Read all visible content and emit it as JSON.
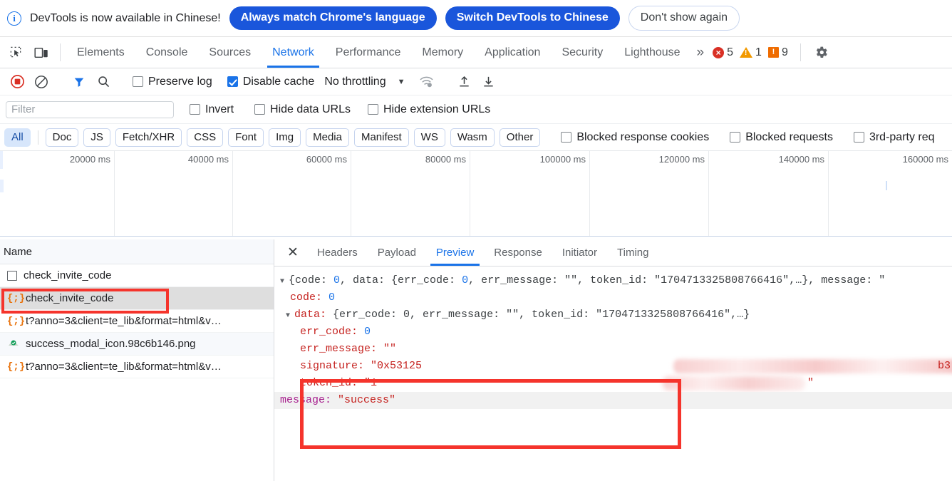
{
  "banner": {
    "icon": "info-circle-icon",
    "text": "DevTools is now available in Chinese!",
    "primary_button": "Always match Chrome's language",
    "secondary_button": "Switch DevTools to Chinese",
    "dismiss_button": "Don't show again"
  },
  "main_tabs": {
    "items": [
      {
        "label": "Elements",
        "active": false
      },
      {
        "label": "Console",
        "active": false
      },
      {
        "label": "Sources",
        "active": false
      },
      {
        "label": "Network",
        "active": true
      },
      {
        "label": "Performance",
        "active": false
      },
      {
        "label": "Memory",
        "active": false
      },
      {
        "label": "Application",
        "active": false
      },
      {
        "label": "Security",
        "active": false
      },
      {
        "label": "Lighthouse",
        "active": false
      }
    ],
    "overflow": "»",
    "counters": {
      "errors": "5",
      "warnings": "1",
      "issues": "9"
    }
  },
  "network_toolbar": {
    "record_icon": "record-stop-icon",
    "clear_icon": "clear-icon",
    "filter_icon": "filter-funnel-icon",
    "search_icon": "search-icon",
    "preserve_log": {
      "label": "Preserve log",
      "checked": false
    },
    "disable_cache": {
      "label": "Disable cache",
      "checked": true
    },
    "throttling": "No throttling",
    "wifi_icon": "network-conditions-icon",
    "import_icon": "import-har-icon",
    "export_icon": "export-har-icon"
  },
  "filter_bar": {
    "filter_placeholder": "Filter",
    "filter_value": "",
    "invert": {
      "label": "Invert",
      "checked": false
    },
    "hide_data_urls": {
      "label": "Hide data URLs",
      "checked": false
    },
    "hide_extension_urls": {
      "label": "Hide extension URLs",
      "checked": false
    }
  },
  "type_filters": {
    "chips": [
      "All",
      "Doc",
      "JS",
      "Fetch/XHR",
      "CSS",
      "Font",
      "Img",
      "Media",
      "Manifest",
      "WS",
      "Wasm",
      "Other"
    ],
    "active_chip": "All",
    "blocked_response_cookies": {
      "label": "Blocked response cookies",
      "checked": false
    },
    "blocked_requests": {
      "label": "Blocked requests",
      "checked": false
    },
    "third_party": {
      "label": "3rd-party req",
      "checked": false
    }
  },
  "timeline": {
    "ticks": [
      "20000 ms",
      "40000 ms",
      "60000 ms",
      "80000 ms",
      "100000 ms",
      "120000 ms",
      "140000 ms",
      "160000 ms"
    ]
  },
  "request_list": {
    "column_header": "Name",
    "rows": [
      {
        "icon": "document-icon",
        "name": "check_invite_code",
        "selected": false
      },
      {
        "icon": "json-icon",
        "name": "check_invite_code",
        "selected": true
      },
      {
        "icon": "json-icon",
        "name": "t?anno=3&client=te_lib&format=html&v…",
        "selected": false
      },
      {
        "icon": "image-icon",
        "name": "success_modal_icon.98c6b146.png",
        "selected": false
      },
      {
        "icon": "json-icon",
        "name": "t?anno=3&client=te_lib&format=html&v…",
        "selected": false
      }
    ]
  },
  "detail_panel": {
    "close_icon": "close-icon",
    "tabs": [
      {
        "label": "Headers",
        "active": false
      },
      {
        "label": "Payload",
        "active": false
      },
      {
        "label": "Preview",
        "active": true
      },
      {
        "label": "Response",
        "active": false
      },
      {
        "label": "Initiator",
        "active": false
      },
      {
        "label": "Timing",
        "active": false
      }
    ],
    "preview": {
      "root_summary_prefix": "{code: ",
      "root_code": "0",
      "root_mid": ", data: {err_code: ",
      "root_err_code": "0",
      "root_mid2": ", err_message: ",
      "root_empty": "\"\"",
      "root_mid3": ", token_id: ",
      "root_token": "\"1704713325808766416\"",
      "root_tail": ",…}, message: \"",
      "code_key": "code:",
      "code_value": "0",
      "data_key": "data:",
      "data_summary": "{err_code: 0, err_message: \"\", token_id: \"1704713325808766416\",…}",
      "err_code_key": "err_code:",
      "err_code_value": "0",
      "err_message_key": "err_message:",
      "err_message_value": "\"\"",
      "signature_key": "signature:",
      "signature_value": "\"0x53125",
      "signature_tail": "b3",
      "token_id_key": "token_id:",
      "token_id_value": "\"1",
      "token_id_close": "\"",
      "message_key": "message:",
      "message_value": "\"success\""
    }
  },
  "colors": {
    "accent": "#1a73e8",
    "primary_button": "#1a56db",
    "highlight_box": "#f5342c",
    "json_key": "#c5221f",
    "json_number": "#1a73e8",
    "error_badge": "#d93025",
    "warning_badge": "#f29900",
    "issue_badge": "#ef6c00"
  }
}
